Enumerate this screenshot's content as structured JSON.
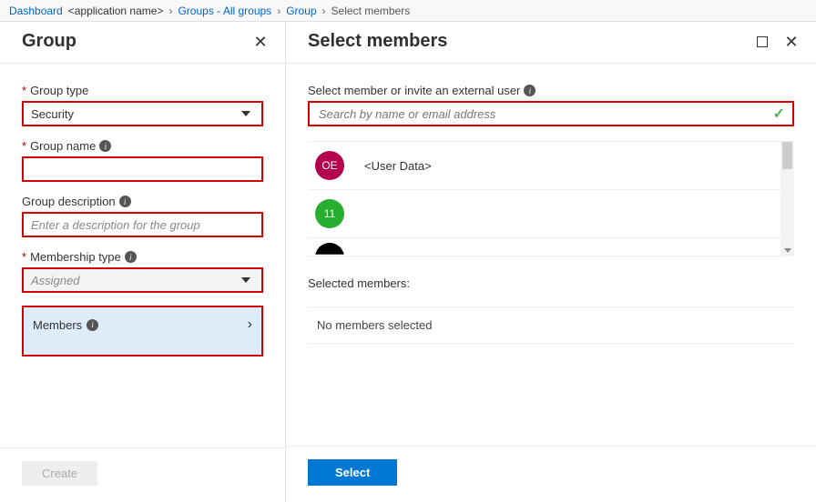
{
  "breadcrumb": {
    "dashboard": "Dashboard",
    "app_name": "<application name>",
    "groups_all": "Groups - All groups",
    "group": "Group",
    "select_members": "Select members"
  },
  "left_panel": {
    "title": "Group",
    "group_type": {
      "label": "Group type",
      "value": "Security"
    },
    "group_name": {
      "label": "Group name",
      "value": ""
    },
    "group_description": {
      "label": "Group description",
      "placeholder": "Enter a description for the group"
    },
    "membership_type": {
      "label": "Membership type",
      "value": "Assigned"
    },
    "members_link": "Members",
    "create_button": "Create"
  },
  "right_panel": {
    "title": "Select members",
    "search_label": "Select member or invite an external user",
    "search_placeholder": "Search by name or email address",
    "members": [
      {
        "initials": "OE",
        "name": "<User Data>",
        "color": "crimson"
      },
      {
        "initials": "11",
        "name": "",
        "color": "green"
      }
    ],
    "selected_label": "Selected members:",
    "no_members_text": "No members selected",
    "select_button": "Select"
  }
}
